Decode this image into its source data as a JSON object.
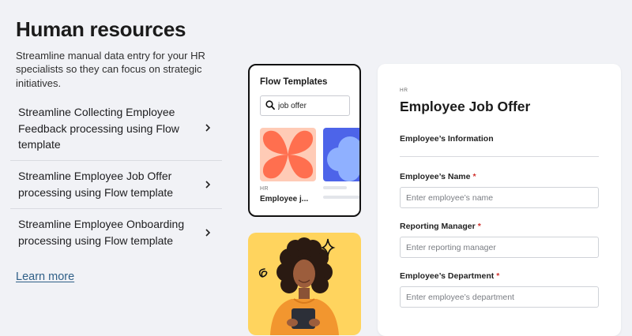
{
  "page": {
    "title": "Human resources",
    "intro": "Streamline manual data entry for your HR specialists so they can focus on strategic initiatives.",
    "accordion": [
      {
        "label": "Streamline Collecting Employee Feedback processing using Flow template"
      },
      {
        "label": "Streamline Employee Job Offer processing using Flow template"
      },
      {
        "label": "Streamline Employee Onboarding processing using Flow template"
      }
    ],
    "learn_more": "Learn more"
  },
  "flow": {
    "title": "Flow Templates",
    "search_value": "job offer",
    "template_tag": "HR",
    "template_name": "Employee j..."
  },
  "form": {
    "tag": "HR",
    "title": "Employee Job Offer",
    "section": "Employee’s Information",
    "fields": [
      {
        "label": "Employee’s Name",
        "required_mark": "*",
        "placeholder": "Enter employee’s name"
      },
      {
        "label": "Reporting Manager",
        "required_mark": "*",
        "placeholder": "Enter reporting manager"
      },
      {
        "label": "Employee’s Department",
        "required_mark": "*",
        "placeholder": "Enter employee’s department"
      }
    ]
  },
  "colors": {
    "background": "#f1f2f6",
    "link": "#2f5f87",
    "required": "#d0312d",
    "thumb_orange": "#ff6f4f",
    "thumb_blue": "#4d64e9",
    "photo_bg": "#ffd45e"
  },
  "icons": [
    "chevron-right-icon",
    "search-icon",
    "sparkle-icon",
    "squiggle-icon"
  ]
}
